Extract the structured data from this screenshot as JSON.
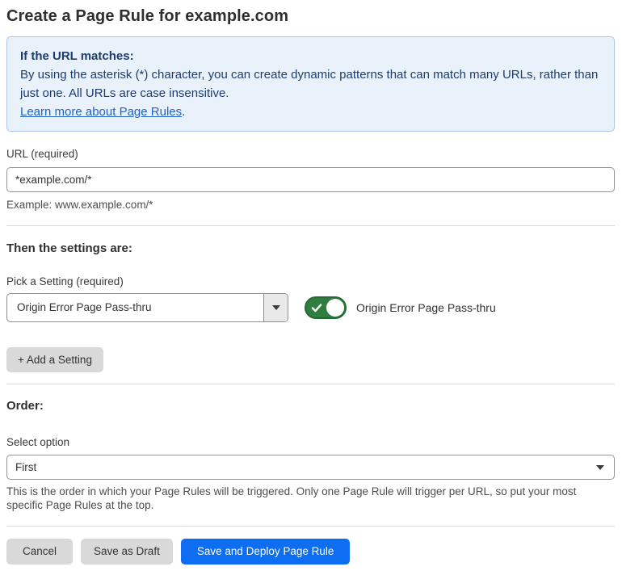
{
  "page": {
    "title": "Create a Page Rule for example.com"
  },
  "info_box": {
    "heading": "If the URL matches:",
    "body": "By using the asterisk (*) character, you can create dynamic patterns that can match many URLs, rather than just one. All URLs are case insensitive.",
    "link_label": "Learn more about Page Rules",
    "link_suffix": "."
  },
  "url_field": {
    "label": "URL (required)",
    "value": "*example.com/*",
    "example": "Example: www.example.com/*"
  },
  "settings_section": {
    "heading": "Then the settings are:",
    "picker_label": "Pick a Setting (required)",
    "picker_value": "Origin Error Page Pass-thru",
    "toggle_state": "on",
    "toggle_label": "Origin Error Page Pass-thru",
    "add_setting_label": "+ Add a Setting"
  },
  "order_section": {
    "heading": "Order:",
    "select_label": "Select option",
    "select_value": "First",
    "help_text": "This is the order in which your Page Rules will be triggered. Only one Page Rule will trigger per URL, so put your most specific Page Rules at the top."
  },
  "footer": {
    "cancel_label": "Cancel",
    "save_draft_label": "Save as Draft",
    "save_deploy_label": "Save and Deploy Page Rule"
  },
  "colors": {
    "info_background": "#e9f1fb",
    "info_border": "#a9c6e8",
    "info_text": "#1c3d6e",
    "link_blue": "#2262c9",
    "toggle_green": "#2f7d3f",
    "primary_button_blue": "#0d6ef2",
    "secondary_button_gray": "#d9d9d9"
  }
}
